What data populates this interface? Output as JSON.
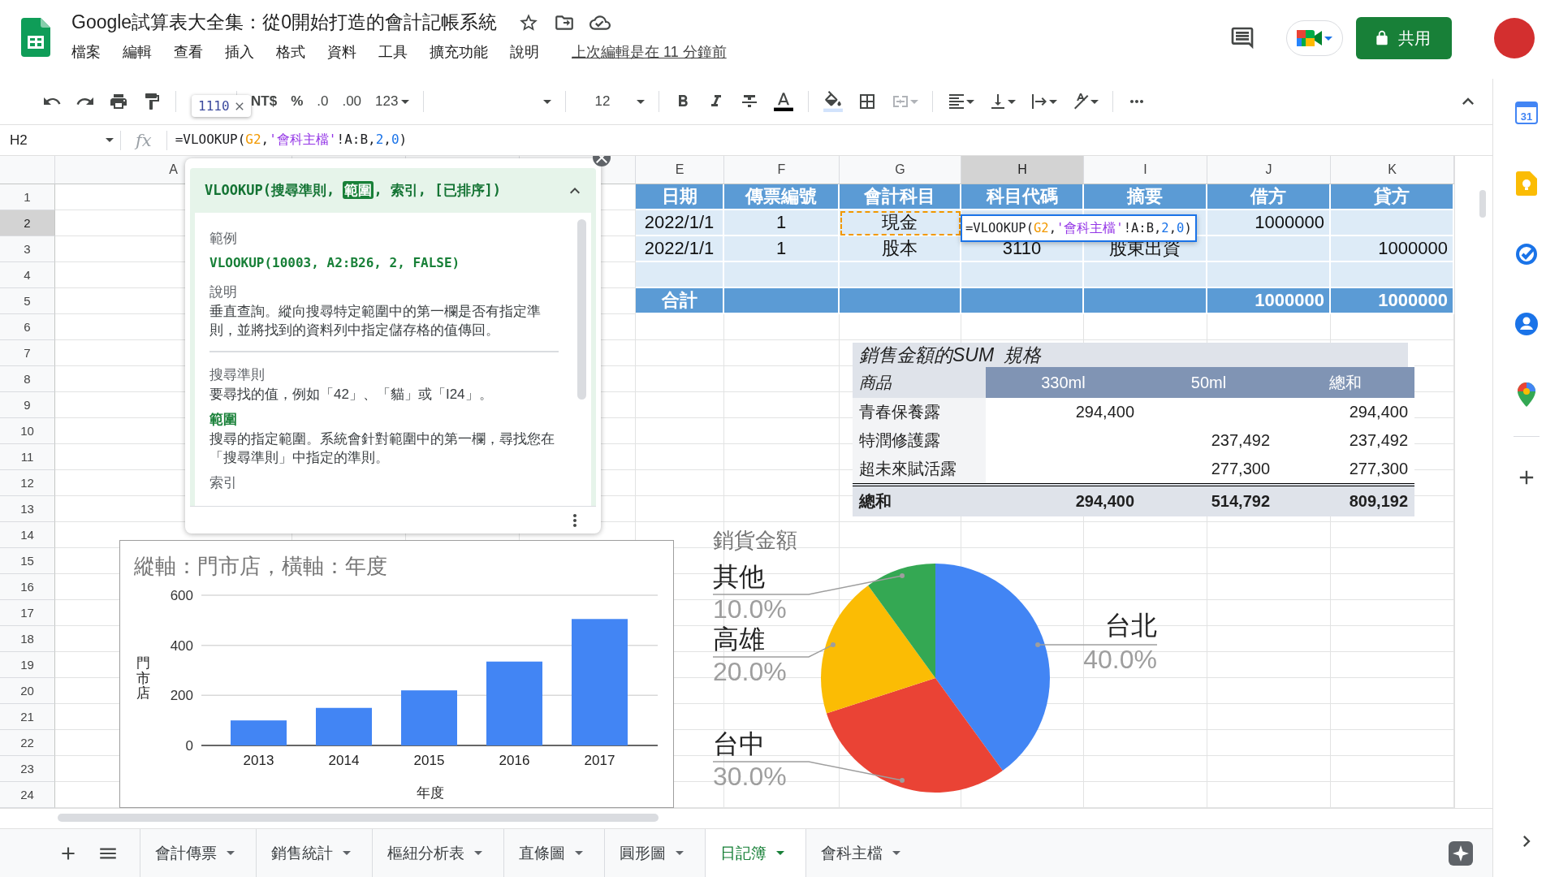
{
  "document": {
    "title": "Google試算表大全集：從0開始打造的會計記帳系統",
    "last_edit": "上次編輯是在 11 分鐘前"
  },
  "menu": [
    "檔案",
    "編輯",
    "查看",
    "插入",
    "格式",
    "資料",
    "工具",
    "擴充功能",
    "說明"
  ],
  "share_button": "共用",
  "toolbar": {
    "value_preview": "1110",
    "format_buttons": [
      "NT$",
      "%",
      ".0",
      ".00",
      "123"
    ],
    "font_size": "12"
  },
  "formula_bar": {
    "name_box": "H2",
    "fx": "fx",
    "formula": [
      {
        "text": "=VLOOKUP(",
        "color": "#202124"
      },
      {
        "text": "G2",
        "color": "#f29900"
      },
      {
        "text": ",",
        "color": "#202124"
      },
      {
        "text": "'會科主檔'",
        "color": "#9334e6"
      },
      {
        "text": "!A:B,",
        "color": "#202124"
      },
      {
        "text": "2",
        "color": "#1a73e8"
      },
      {
        "text": ",",
        "color": "#202124"
      },
      {
        "text": "0",
        "color": "#1a73e8"
      },
      {
        "text": ")",
        "color": "#202124"
      }
    ]
  },
  "side_panel": {
    "calendar_day": "31"
  },
  "column_headers": [
    {
      "label": "A",
      "selected": false
    },
    {
      "label": "E",
      "selected": false
    },
    {
      "label": "F",
      "selected": false
    },
    {
      "label": "G",
      "selected": false
    },
    {
      "label": "H",
      "selected": true
    },
    {
      "label": "I",
      "selected": false
    },
    {
      "label": "J",
      "selected": false
    },
    {
      "label": "K",
      "selected": false
    }
  ],
  "row_headers": [
    {
      "label": "1",
      "selected": false
    },
    {
      "label": "2",
      "selected": true
    },
    {
      "label": "3",
      "selected": false
    },
    {
      "label": "4",
      "selected": false
    },
    {
      "label": "5",
      "selected": false
    },
    {
      "label": "6",
      "selected": false
    },
    {
      "label": "7",
      "selected": false
    },
    {
      "label": "8",
      "selected": false
    },
    {
      "label": "9",
      "selected": false
    },
    {
      "label": "10",
      "selected": false
    },
    {
      "label": "11",
      "selected": false
    },
    {
      "label": "12",
      "selected": false
    },
    {
      "label": "13",
      "selected": false
    },
    {
      "label": "14",
      "selected": false
    },
    {
      "label": "15",
      "selected": false
    },
    {
      "label": "16",
      "selected": false
    },
    {
      "label": "17",
      "selected": false
    },
    {
      "label": "18",
      "selected": false
    },
    {
      "label": "19",
      "selected": false
    },
    {
      "label": "20",
      "selected": false
    },
    {
      "label": "21",
      "selected": false
    },
    {
      "label": "22",
      "selected": false
    },
    {
      "label": "23",
      "selected": false
    },
    {
      "label": "24",
      "selected": false
    }
  ],
  "journal_table": {
    "rows": [
      {
        "kind": "header",
        "cells": [
          {
            "text": "日期",
            "referenced": false
          },
          {
            "text": "傳票編號",
            "referenced": false
          },
          {
            "text": "會計科目",
            "referenced": false
          },
          {
            "text": "科目代碼",
            "referenced": false
          },
          {
            "text": "摘要",
            "referenced": false
          },
          {
            "text": "借方",
            "referenced": false
          },
          {
            "text": "貸方",
            "referenced": false
          }
        ]
      },
      {
        "kind": "data",
        "cells": [
          {
            "text": "2022/1/1",
            "referenced": false
          },
          {
            "text": "1",
            "referenced": false
          },
          {
            "text": "現金",
            "referenced": true
          },
          {
            "referenced": false
          },
          {
            "referenced": false
          },
          {
            "text": "1000000",
            "referenced": false
          },
          {
            "referenced": false
          }
        ]
      },
      {
        "kind": "data",
        "cells": [
          {
            "text": "2022/1/1",
            "referenced": false
          },
          {
            "text": "1",
            "referenced": false
          },
          {
            "text": "股本",
            "referenced": false
          },
          {
            "text": "3110",
            "referenced": false
          },
          {
            "text": "股東出資",
            "referenced": false
          },
          {
            "referenced": false
          },
          {
            "text": "1000000",
            "referenced": false
          }
        ]
      },
      {
        "kind": "data",
        "cells": [
          {
            "referenced": false
          },
          {
            "referenced": false
          },
          {
            "referenced": false
          },
          {
            "referenced": false
          },
          {
            "referenced": false
          },
          {
            "referenced": false
          },
          {
            "referenced": false
          }
        ]
      },
      {
        "kind": "total",
        "cells": [
          {
            "text": "合計",
            "referenced": false
          },
          {
            "referenced": false
          },
          {
            "referenced": false
          },
          {
            "referenced": false
          },
          {
            "referenced": false
          },
          {
            "text": "1000000",
            "referenced": false
          },
          {
            "text": "1000000",
            "referenced": false
          }
        ]
      }
    ]
  },
  "cell_editor": {
    "formula": [
      {
        "text": "=VLOOKUP(",
        "color": "#202124"
      },
      {
        "text": "G2",
        "color": "#f29900"
      },
      {
        "text": ",",
        "color": "#202124"
      },
      {
        "text": "'會科主檔'",
        "color": "#9334e6"
      },
      {
        "text": "!A:B,",
        "color": "#202124"
      },
      {
        "text": "2",
        "color": "#1a73e8"
      },
      {
        "text": ",",
        "color": "#202124"
      },
      {
        "text": "0",
        "color": "#1a73e8"
      },
      {
        "text": ")",
        "color": "#202124"
      }
    ]
  },
  "formula_help": {
    "signature": [
      {
        "text": "VLOOKUP(",
        "selected": false
      },
      {
        "text": "搜尋準則",
        "selected": false
      },
      {
        "text": ", ",
        "selected": false
      },
      {
        "text": "範圍",
        "selected": true
      },
      {
        "text": ", 索引, [已排序])",
        "selected": false
      }
    ],
    "sections": [
      {
        "kind": "example",
        "heading": "範例",
        "body": "VLOOKUP(10003, A2:B26, 2, FALSE)"
      },
      {
        "kind": "summary",
        "heading": "說明",
        "body": "垂直查詢。縱向搜尋特定範圍中的第一欄是否有指定準則，並將找到的資料列中指定儲存格的值傳回。"
      },
      {
        "kind": "argument",
        "heading": "搜尋準則",
        "body": "要尋找的值，例如「42」、「貓」或「I24」。",
        "selected": false
      },
      {
        "kind": "argument",
        "heading": "範圍",
        "body": "搜尋的指定範圍。系統會針對範圍中的第一欄，尋找您在「搜尋準則」中指定的準則。",
        "selected": true
      },
      {
        "kind": "argument",
        "heading": "索引",
        "selected": false
      }
    ]
  },
  "pivot_table": {
    "value_label": "銷售金額的SUM",
    "column_field": "規格",
    "row_field": "商品",
    "columns": [
      "330ml",
      "50ml",
      "總和"
    ],
    "rows": [
      {
        "label": "青春保養露",
        "values": {
          "column_1": "294,400",
          "column_3": "294,400"
        }
      },
      {
        "label": "特潤修護露",
        "values": {
          "column_2": "237,492",
          "column_3": "237,492"
        }
      },
      {
        "label": "超未來賦活露",
        "values": {
          "column_2": "277,300",
          "column_3": "277,300"
        }
      }
    ],
    "total": {
      "label": "總和",
      "values": [
        "294,400",
        "514,792",
        "809,192"
      ]
    }
  },
  "bar_chart": {
    "chart_data": {
      "type": "bar",
      "title": "縱軸：門市店，橫軸：年度",
      "xlabel": "年度",
      "ylabel": "門市店",
      "categories": [
        "2013",
        "2014",
        "2015",
        "2016",
        "2017"
      ],
      "series": [
        {
          "color": "#4285f4",
          "values": [
            100,
            150,
            220,
            335,
            505
          ]
        }
      ],
      "ylim": [
        0,
        600
      ],
      "yticks": [
        0,
        200,
        400,
        600
      ]
    }
  },
  "pie_chart": {
    "chart_data": {
      "type": "pie",
      "title": "銷貨金額",
      "categories": [
        "台北",
        "台中",
        "高雄",
        "其他"
      ],
      "series": [
        {
          "values": [
            40,
            30,
            20,
            10
          ]
        }
      ],
      "colors": [
        "#4285f4",
        "#ea4335",
        "#fbbc04",
        "#34a853"
      ],
      "value_labels": [
        "40.0%",
        "30.0%",
        "20.0%",
        "10.0%"
      ]
    }
  },
  "sheet_tabs": [
    {
      "label": "會計傳票",
      "selected": false
    },
    {
      "label": "銷售統計",
      "selected": false
    },
    {
      "label": "樞紐分析表",
      "selected": false
    },
    {
      "label": "直條圖",
      "selected": false
    },
    {
      "label": "圓形圖",
      "selected": false
    },
    {
      "label": "日記簿",
      "selected": true
    },
    {
      "label": "會科主檔",
      "selected": false
    }
  ]
}
